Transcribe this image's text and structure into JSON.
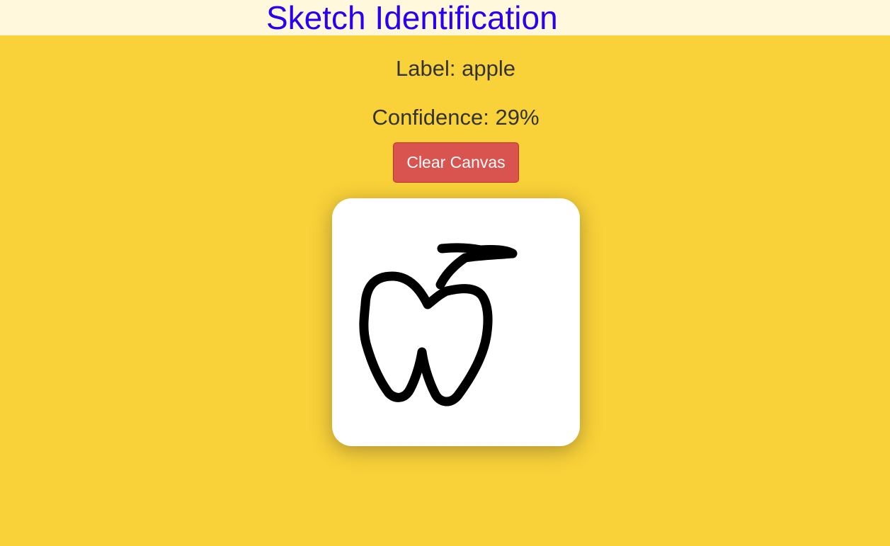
{
  "header": {
    "title": "Sketch Identification",
    "background": "#fff8dc",
    "title_color": "#2a00f0"
  },
  "result": {
    "label_prefix": "Label:",
    "label_value": "apple",
    "confidence_prefix": "Confidence:",
    "confidence_value": "29%"
  },
  "controls": {
    "clear_label": "Clear Canvas",
    "clear_color": "#d9534f"
  },
  "canvas": {
    "background": "#ffffff",
    "stroke_color": "#000000",
    "drawing": "apple sketch"
  },
  "page": {
    "background": "#f9d138"
  }
}
